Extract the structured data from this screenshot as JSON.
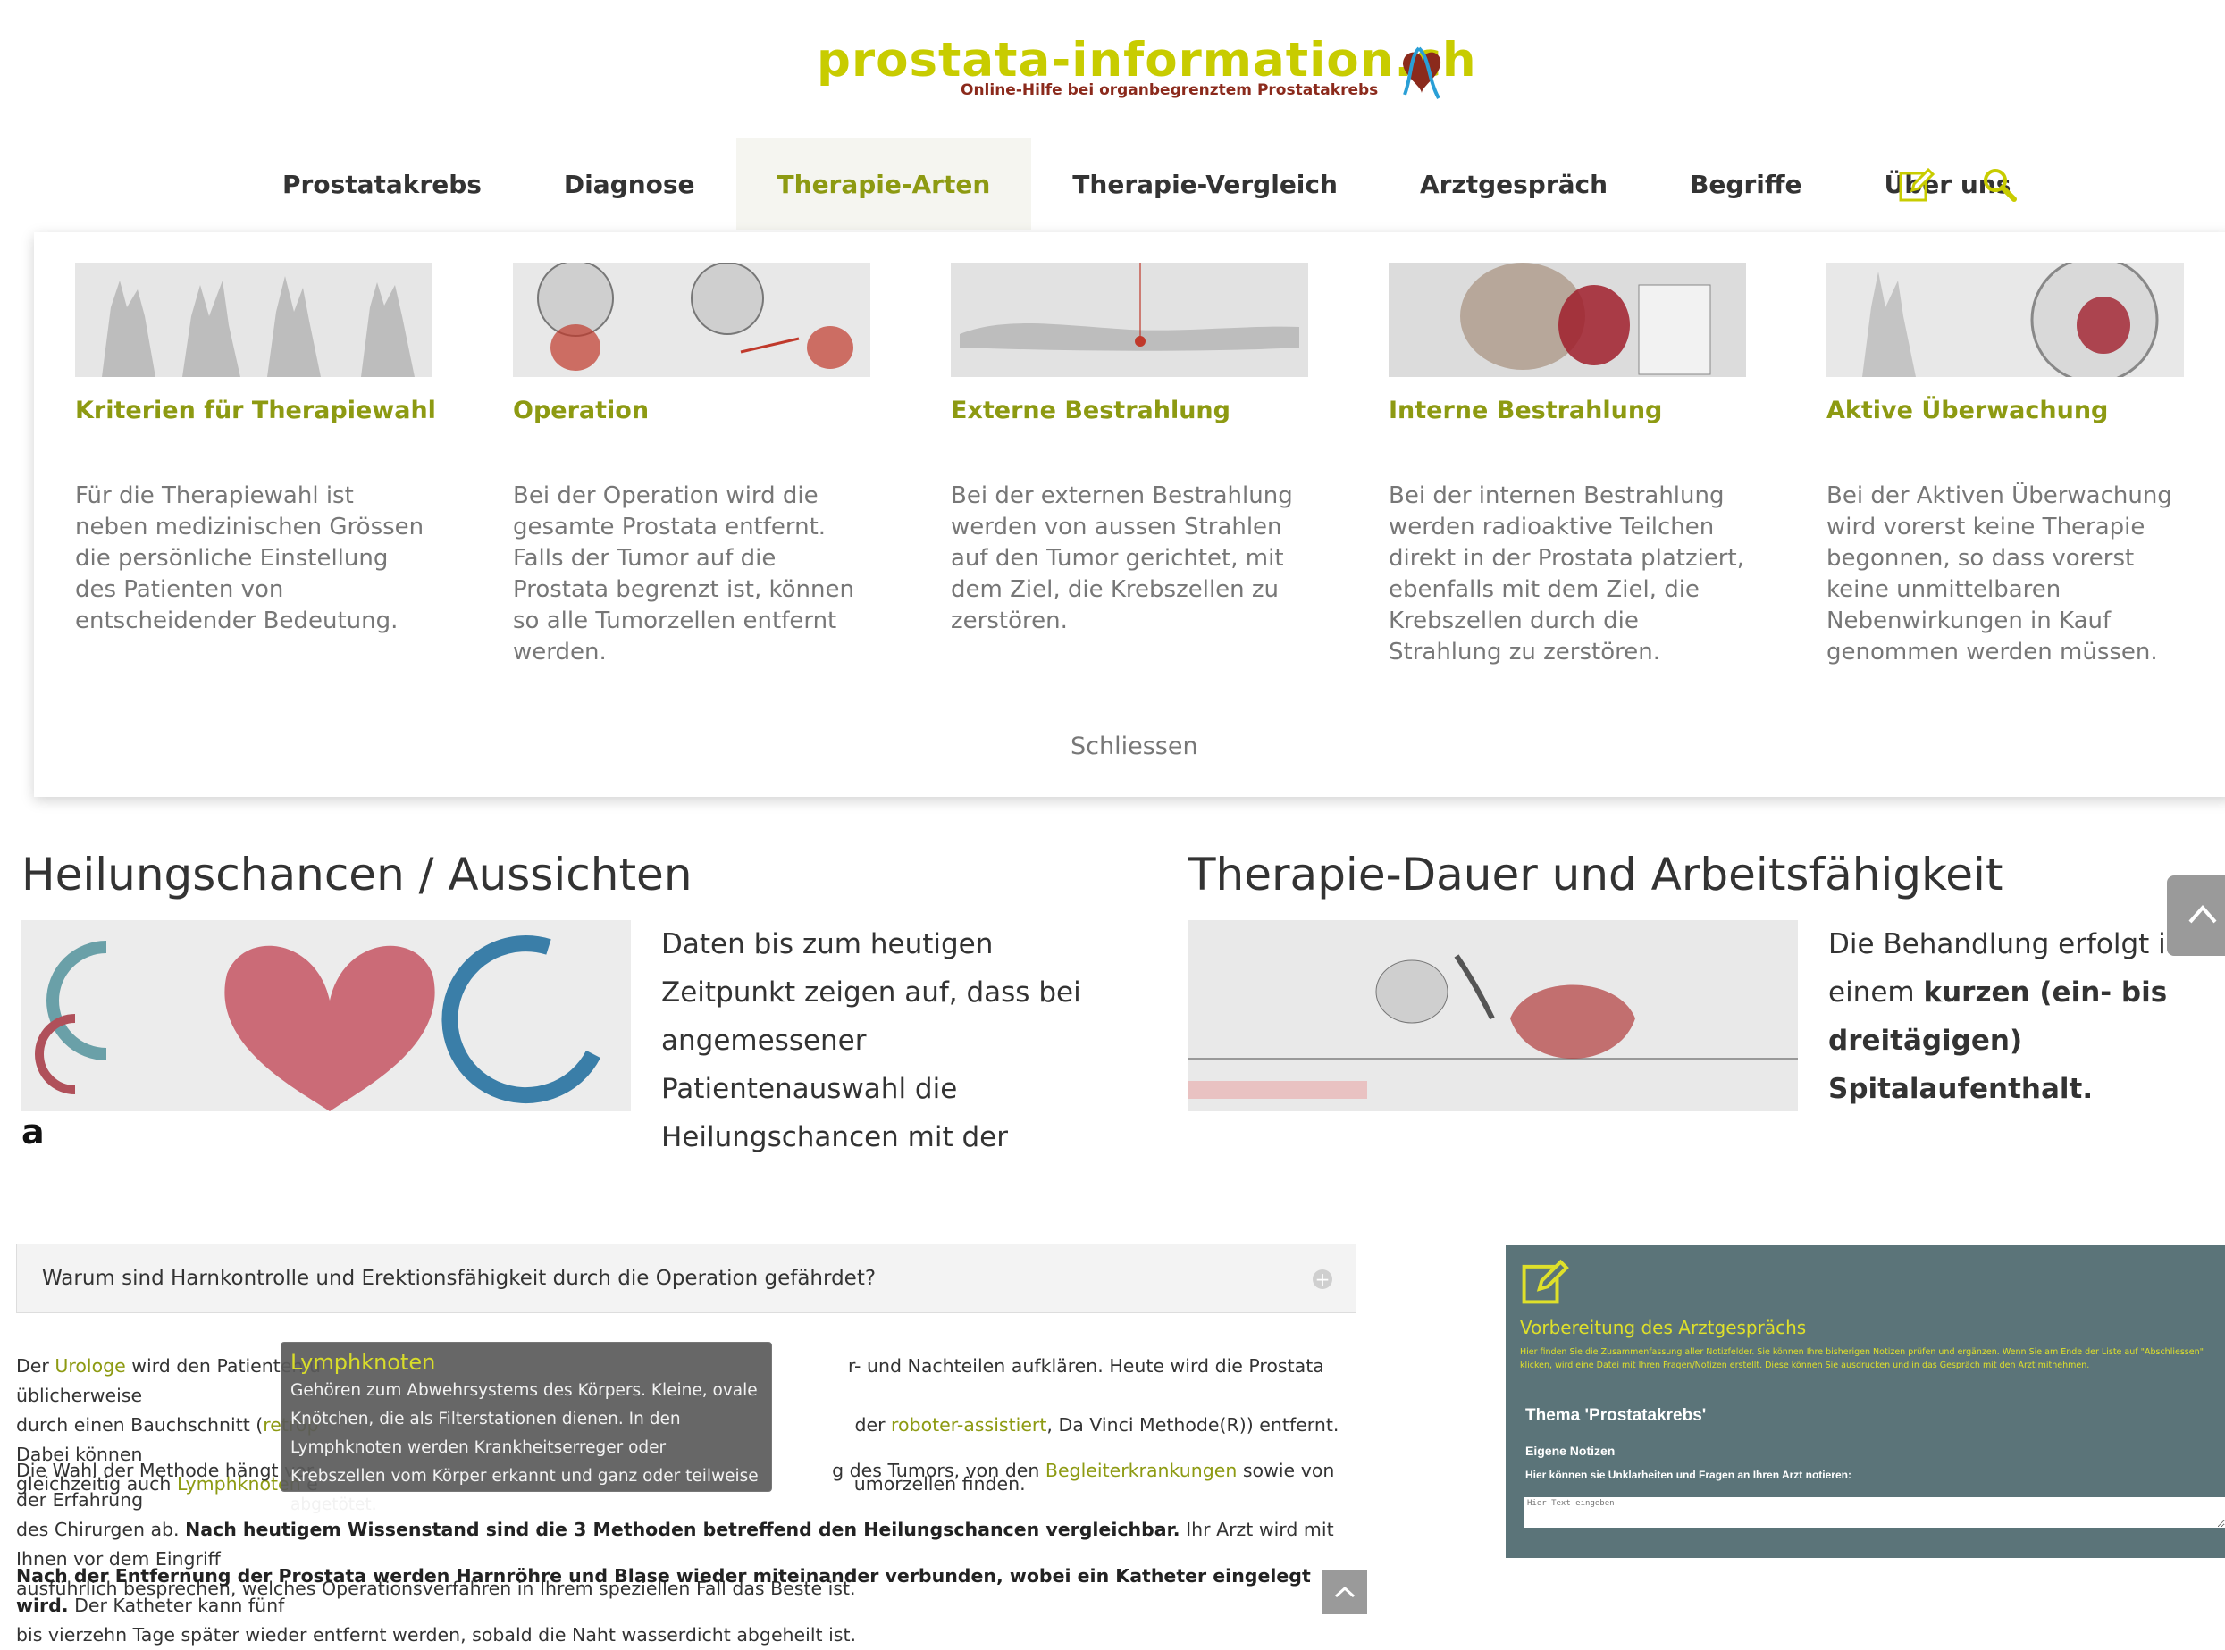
{
  "logo": {
    "title": "prostata-information.ch",
    "tagline": "Online-Hilfe bei organbegrenztem Prostatakrebs"
  },
  "nav": {
    "items": [
      {
        "label": "Prostatakrebs"
      },
      {
        "label": "Diagnose"
      },
      {
        "label": "Therapie-Arten"
      },
      {
        "label": "Therapie-Vergleich"
      },
      {
        "label": "Arztgespräch"
      },
      {
        "label": "Begriffe"
      },
      {
        "label": "Über uns"
      }
    ],
    "active_index": 2
  },
  "mega_menu": {
    "cards": [
      {
        "title": "Kriterien für Therapiewahl",
        "text": "Für die Therapiewahl ist neben medizinischen Grössen die persönliche Einstellung des Patienten von entscheidender Bedeutung."
      },
      {
        "title": "Operation",
        "text": "Bei der Operation wird die gesamte Prostata entfernt. Falls der Tumor auf die Prostata begrenzt ist, können so alle Tumorzellen entfernt werden."
      },
      {
        "title": "Externe Bestrahlung",
        "text": "Bei der externen Bestrahlung werden von aussen Strahlen auf den Tumor gerichtet, mit dem Ziel, die Krebszellen zu zerstören."
      },
      {
        "title": "Interne Bestrahlung",
        "text": "Bei der internen Bestrahlung werden radioaktive Teilchen direkt in der Prostata platziert, ebenfalls mit dem Ziel, die Krebszellen durch die Strahlung zu zerstören."
      },
      {
        "title": "Aktive Überwachung",
        "text": "Bei der Aktiven Überwachung wird vorerst keine Therapie begonnen, so dass vorerst keine unmittelbaren Nebenwirkungen in Kauf genommen werden müssen."
      }
    ],
    "close_label": "Schliessen"
  },
  "sections": {
    "left_heading": "Heilungschancen / Aussichten",
    "left_text": "Daten bis zum heutigen Zeitpunkt zeigen auf, dass bei angemessener Patientenauswahl die Heilungschancen mit der",
    "right_heading": "Therapie-Dauer und Arbeitsfähigkeit",
    "right_text_1": "Die Behandlung erfolgt in einem ",
    "right_text_bold": "kurzen (ein- bis dreitägigen) Spitalaufenthalt.",
    "stray_letter": "a"
  },
  "accordion": {
    "label": "Warum sind Harnkontrolle und Erektionsfähigkeit durch die Operation gefährdet?",
    "icon": "plus-circle-icon"
  },
  "body": {
    "p1": {
      "t1": "Der ",
      "l1": "Urologe",
      "t2": " wird den Patienten ü",
      "t3": "r- und Nachteilen aufklären. Heute wird die Prostata üblicherweise",
      "t4": "durch einen Bauchschnitt (",
      "l2": "retrop",
      "t5": "der ",
      "l3": "roboter-assistiert",
      "t6": ", Da Vinci Methode(R)) entfernt. Dabei können",
      "t7": "gleichzeitig auch ",
      "l4": "Lymphknoten",
      "t8": " e",
      "t9": "umorzellen finden."
    },
    "p2": {
      "t1": "Die Wahl der Methode hängt vor",
      "t2": "g des Tumors, von den ",
      "l1": "Begleiterkrankungen",
      "t3": " sowie von der Erfahrung",
      "t4": "des Chirurgen ab. ",
      "b1": "Nach heutigem Wissenstand sind die 3 Methoden betreffend den Heilungschancen vergleichbar.",
      "t5": " Ihr Arzt wird mit Ihnen vor dem Eingriff",
      "t6": "ausführlich besprechen, welches Operationsverfahren in Ihrem speziellen Fall das Beste ist."
    },
    "p3": {
      "b1": "Nach der Entfernung der Prostata werden Harnröhre und Blase wieder miteinander verbunden, wobei ein Katheter eingelegt wird.",
      "t1": " Der Katheter kann fünf",
      "t2": "bis vierzehn Tage später wieder entfernt werden, sobald die Naht wasserdicht abgeheilt ist."
    }
  },
  "tooltip": {
    "title": "Lymphknoten",
    "body": "Gehören zum Abwehrsystems des Körpers. Kleine, ovale Knötchen, die als Filterstationen dienen. In den Lymphknoten werden Krankheitserreger oder Krebszellen vom Körper erkannt und ganz oder teilweise abgetötet."
  },
  "panel": {
    "title": "Vorbereitung des Arztgesprächs",
    "description": "Hier finden Sie die Zusammenfassung aller Notizfelder. Sie können Ihre bisherigen Notizen prüfen und ergänzen. Wenn Sie am Ende der Liste auf \"Abschliessen\" klicken, wird eine Datei mit Ihren Fragen/Notizen erstellt. Diese können Sie ausdrucken und in das Gespräch mit den Arzt mitnehmen.",
    "theme": "Thema 'Prostatakrebs'",
    "notes_heading": "Eigene Notizen",
    "notes_hint": "Hier können sie Unklarheiten und Fragen an Ihren Arzt notieren:",
    "input_placeholder": "Hier Text eingeben"
  },
  "colors": {
    "accent": "#8d9a12",
    "logo": "#c8cc00",
    "panel_bg": "#5b7479"
  }
}
